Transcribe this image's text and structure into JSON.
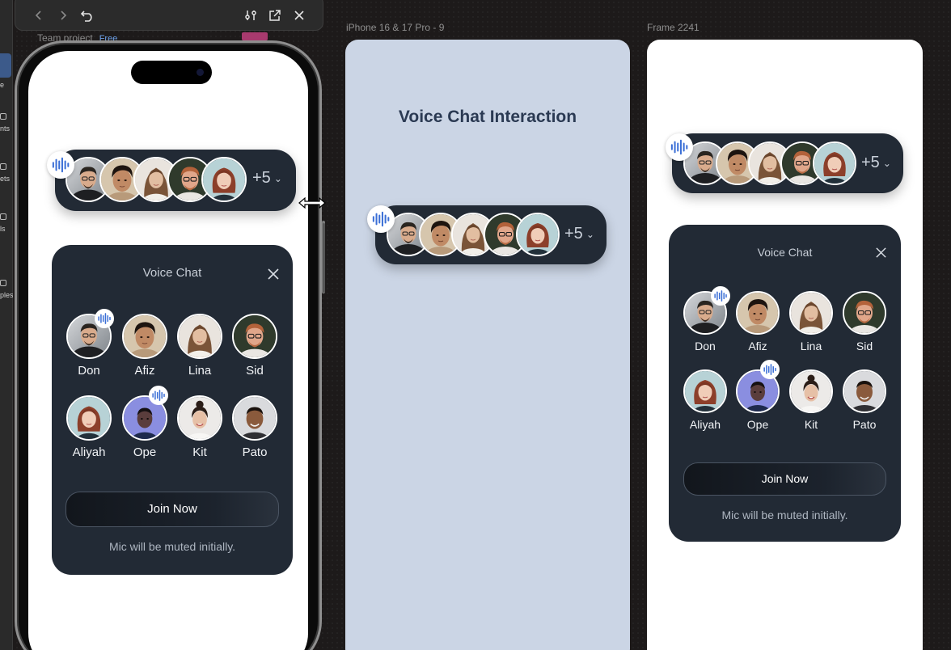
{
  "sidebar": {
    "items": [
      {
        "label": "e"
      },
      {
        "label": "nts"
      },
      {
        "label": "ets"
      },
      {
        "label": "ls"
      },
      {
        "label": "ples"
      }
    ]
  },
  "toolbar": {
    "icons": [
      "chevron-left-icon",
      "chevron-right-icon",
      "undo-icon",
      "sliders-icon",
      "open-external-icon",
      "close-icon"
    ]
  },
  "workspace": {
    "project_name": "Team project",
    "plan_badge": "Free"
  },
  "frames": {
    "middle_label": "iPhone 16 & 17 Pro - 9",
    "right_label": "Frame 2241"
  },
  "middle": {
    "title": "Voice Chat Interaction"
  },
  "pill": {
    "extra_count": "+5"
  },
  "card": {
    "title": "Voice Chat",
    "members": [
      {
        "name": "Don",
        "speaking": true
      },
      {
        "name": "Afiz",
        "speaking": false
      },
      {
        "name": "Lina",
        "speaking": false
      },
      {
        "name": "Sid",
        "speaking": false
      },
      {
        "name": "Aliyah",
        "speaking": false
      },
      {
        "name": "Ope",
        "speaking": true
      },
      {
        "name": "Kit",
        "speaking": false
      },
      {
        "name": "Pato",
        "speaking": false
      }
    ],
    "join_label": "Join Now",
    "muted_note": "Mic will be muted initially."
  },
  "colors": {
    "card_bg": "#222a35",
    "accent_blue": "#3b6fd6",
    "middle_frame_bg": "#cbd5e5",
    "middle_title": "#2b3a53"
  }
}
